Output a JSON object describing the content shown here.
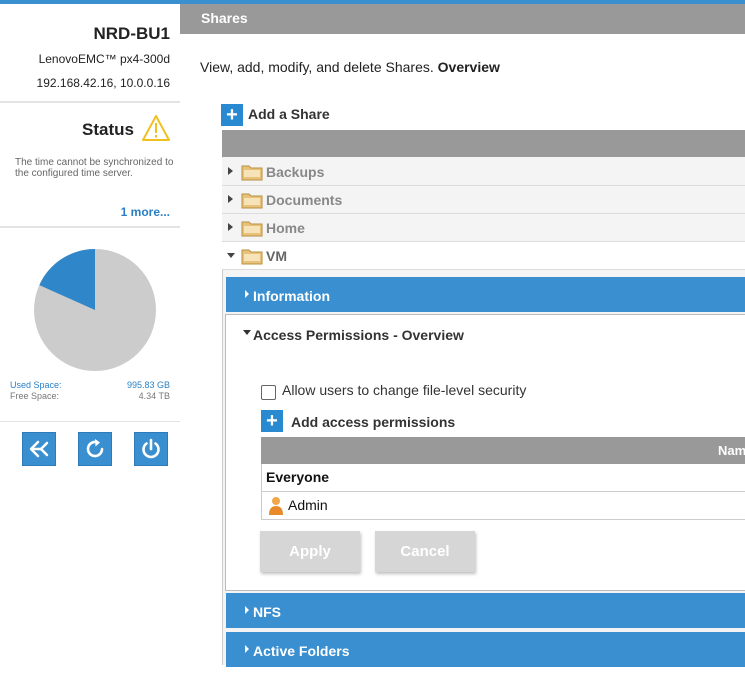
{
  "device": {
    "name": "NRD-BU1",
    "model": "LenovoEMC™ px4-300d",
    "ip": "192.168.42.16, 10.0.0.16"
  },
  "status": {
    "title": "Status",
    "message": "The time cannot be synchronized to the configured time server.",
    "more_link": "1 more..."
  },
  "storage": {
    "used_label": "Used Space:",
    "used_value": "995.83 GB",
    "free_label": "Free Space:",
    "free_value": "4.34 TB",
    "used_fraction": 0.183,
    "used_color": "#2f86c9",
    "free_color": "#cccccc"
  },
  "actions": [
    {
      "icon": "eject-icon"
    },
    {
      "icon": "restart-icon"
    },
    {
      "icon": "power-icon"
    }
  ],
  "page": {
    "title": "Shares",
    "description": "View, add, modify, and delete Shares.",
    "description_bold": "Overview",
    "add_share_label": "Add a Share"
  },
  "shares": [
    {
      "name": "Backups",
      "expanded": false
    },
    {
      "name": "Documents",
      "expanded": false
    },
    {
      "name": "Home",
      "expanded": false
    },
    {
      "name": "VM",
      "expanded": true
    }
  ],
  "sections": {
    "information": "Information",
    "access_permissions": "Access Permissions - Overview",
    "nfs": "NFS",
    "active_folders": "Active Folders"
  },
  "permissions": {
    "allow_file_level_label": "Allow users to change file-level security",
    "allow_file_level_checked": false,
    "add_label": "Add access permissions",
    "column_name": "Name",
    "rows": [
      {
        "name": "Everyone",
        "type": "group"
      },
      {
        "name": "Admin",
        "type": "user"
      }
    ],
    "apply_label": "Apply",
    "cancel_label": "Cancel"
  },
  "colors": {
    "accent": "#3a8fd0",
    "header_gray": "#999999",
    "warning": "#f0c020"
  }
}
